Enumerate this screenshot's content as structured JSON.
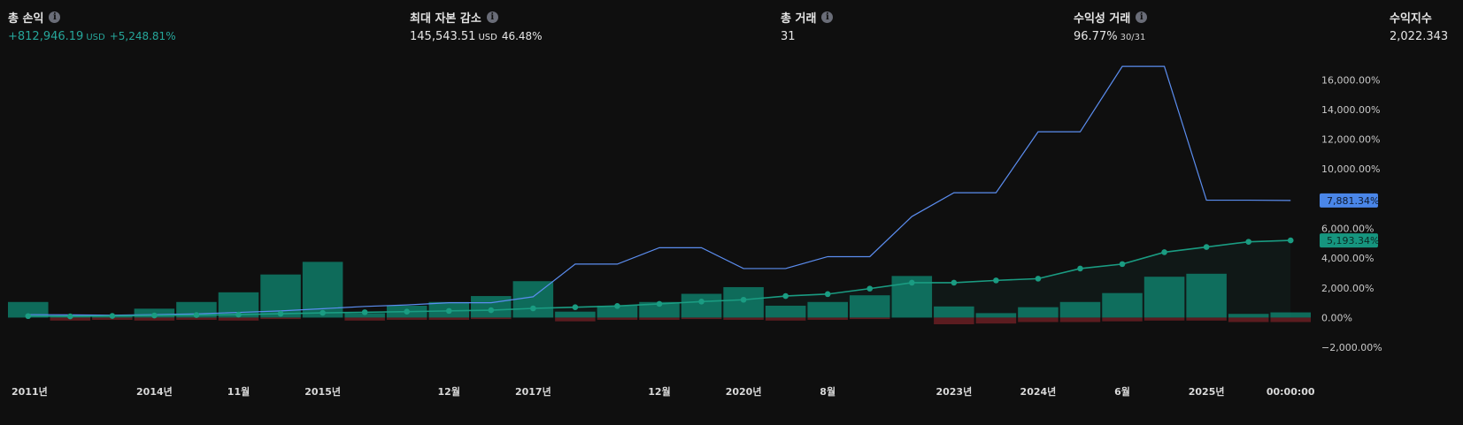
{
  "stats": [
    {
      "label": "총 손익",
      "value": "+812,946.19",
      "unit": "USD",
      "extra": "+5,248.81%",
      "value_color": "#26a69a"
    },
    {
      "label": "최대 자본 감소",
      "value": "145,543.51",
      "unit": "USD",
      "extra": "46.48%",
      "value_color": "#e6e6e6"
    },
    {
      "label": "총 거래",
      "value": "31",
      "unit": "",
      "extra": "",
      "value_color": "#e6e6e6"
    },
    {
      "label": "수익성 거래",
      "value": "96.77%",
      "unit": "",
      "extra": "30/31",
      "value_color": "#e6e6e6"
    },
    {
      "label": "수익지수",
      "value": "2,022.343",
      "unit": "",
      "extra": "",
      "value_color": "#e6e6e6"
    }
  ],
  "info_icon": "info-icon",
  "chart_data": {
    "type": "line",
    "y_ticks": [
      -2000,
      0,
      2000,
      4000,
      6000,
      8000,
      10000,
      12000,
      14000,
      16000
    ],
    "y_tick_labels": [
      "−2,000.00%",
      "0.00%",
      "2,000.00%",
      "4,000.00%",
      "6,000.00%",
      "8,000.00%",
      "10,000.00%",
      "12,000.00%",
      "14,000.00%",
      "16,000.00%"
    ],
    "ylim": [
      -3600,
      17800
    ],
    "x_ticks": [
      {
        "label": "2011년",
        "i": 0
      },
      {
        "label": "2014년",
        "i": 3
      },
      {
        "label": "11월",
        "i": 5
      },
      {
        "label": "2015년",
        "i": 7
      },
      {
        "label": "12월",
        "i": 10
      },
      {
        "label": "2017년",
        "i": 12
      },
      {
        "label": "12월",
        "i": 15
      },
      {
        "label": "2020년",
        "i": 17
      },
      {
        "label": "8월",
        "i": 19
      },
      {
        "label": "2023년",
        "i": 22
      },
      {
        "label": "2024년",
        "i": 24
      },
      {
        "label": "6월",
        "i": 26
      },
      {
        "label": "2025년",
        "i": 28
      },
      {
        "label": "00:00:00",
        "i": 30
      }
    ],
    "series": [
      {
        "color": "#5b8def",
        "values": [
          200,
          180,
          160,
          200,
          250,
          350,
          450,
          600,
          750,
          850,
          1000,
          1000,
          1400,
          3600,
          3600,
          4700,
          4700,
          3300,
          3300,
          4100,
          4100,
          6800,
          8400,
          8400,
          12500,
          12500,
          16900,
          16900,
          7900,
          7900,
          7881
        ],
        "end_label": "7,881.34%"
      },
      {
        "color": "#1a9c82",
        "values": [
          100,
          80,
          110,
          140,
          170,
          200,
          260,
          320,
          360,
          400,
          450,
          500,
          620,
          700,
          780,
          920,
          1080,
          1200,
          1450,
          1580,
          1950,
          2350,
          2350,
          2500,
          2620,
          3300,
          3600,
          4400,
          4750,
          5100,
          5193
        ],
        "end_label": "5,193.34%"
      }
    ],
    "bars_positive": [
      1050,
      150,
      150,
      600,
      1050,
      1700,
      2900,
      3750,
      300,
      800,
      1050,
      1450,
      2450,
      400,
      800,
      1050,
      1600,
      2050,
      800,
      1050,
      1500,
      2800,
      750,
      300,
      700,
      1050,
      1650,
      2750,
      2950,
      250,
      350
    ],
    "bars_negative": [
      0,
      -200,
      -150,
      -200,
      -150,
      -200,
      -100,
      0,
      -200,
      -150,
      -150,
      -100,
      0,
      -250,
      -150,
      -150,
      -100,
      -150,
      -200,
      -150,
      -100,
      0,
      -450,
      -400,
      -300,
      -300,
      -250,
      -200,
      -200,
      -300,
      -300
    ],
    "bar_color_positive": "#0e6b5a",
    "bar_color_negative": "#5c1c20",
    "grid": false
  }
}
